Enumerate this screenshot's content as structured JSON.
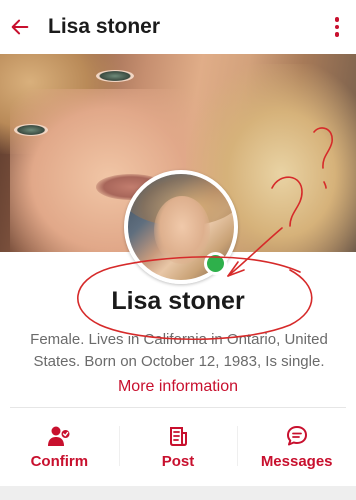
{
  "header": {
    "title": "Lisa stoner",
    "back_icon": "arrow-left-icon",
    "menu_icon": "more-vertical-icon"
  },
  "profile": {
    "name": "Lisa stoner",
    "bio": "Female. Lives in California in Ontario, United States. Born on October 12, 1983, Is single.",
    "more_info_label": "More information",
    "online_status_color": "#2eb04b"
  },
  "actions": [
    {
      "label": "Confirm",
      "icon": "user-plus-icon"
    },
    {
      "label": "Post",
      "icon": "post-icon"
    },
    {
      "label": "Messages",
      "icon": "chat-bubble-icon"
    }
  ],
  "colors": {
    "accent": "#c8102e",
    "background": "#ffffff"
  }
}
